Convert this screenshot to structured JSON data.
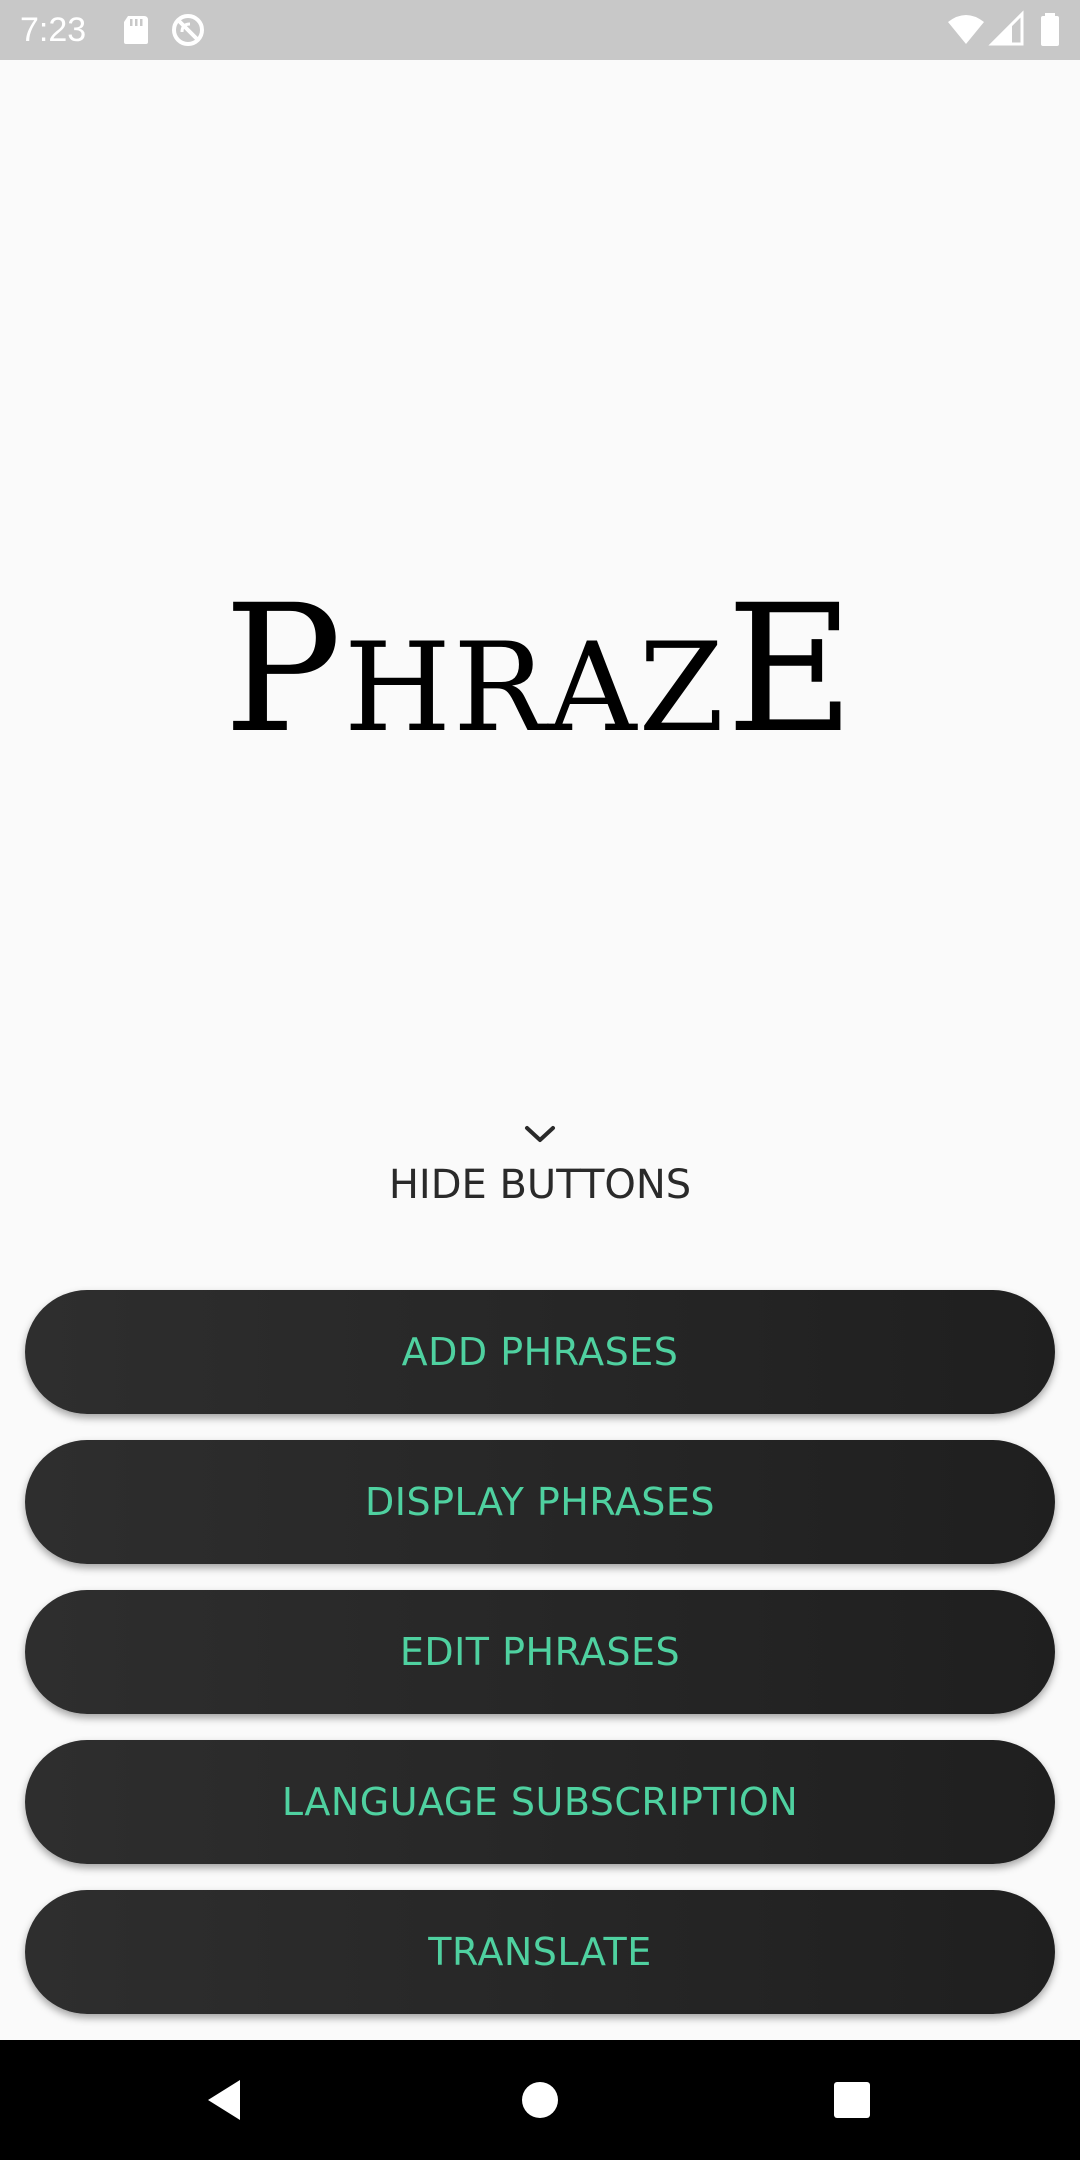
{
  "status_bar": {
    "time": "7:23",
    "left_icons": [
      "sd-card-icon",
      "sync-disabled-icon"
    ],
    "right_icons": [
      "wifi-icon",
      "cell-signal-icon",
      "battery-icon"
    ]
  },
  "app": {
    "title": "PhrazE"
  },
  "toggle": {
    "label": "HIDE BUTTONS",
    "icon": "chevron-down-icon"
  },
  "menu": {
    "buttons": [
      {
        "label": "ADD PHRASES"
      },
      {
        "label": "DISPLAY PHRASES"
      },
      {
        "label": "EDIT PHRASES"
      },
      {
        "label": "LANGUAGE SUBSCRIPTION"
      },
      {
        "label": "TRANSLATE"
      }
    ]
  },
  "nav_bar": {
    "icons": [
      "back-icon",
      "home-icon",
      "recents-icon"
    ]
  },
  "colors": {
    "background": "#fafafa",
    "status_bar": "#c8c8c8",
    "button_bg": "#262626",
    "button_text": "#4fd1a0",
    "nav_bar": "#000000"
  }
}
